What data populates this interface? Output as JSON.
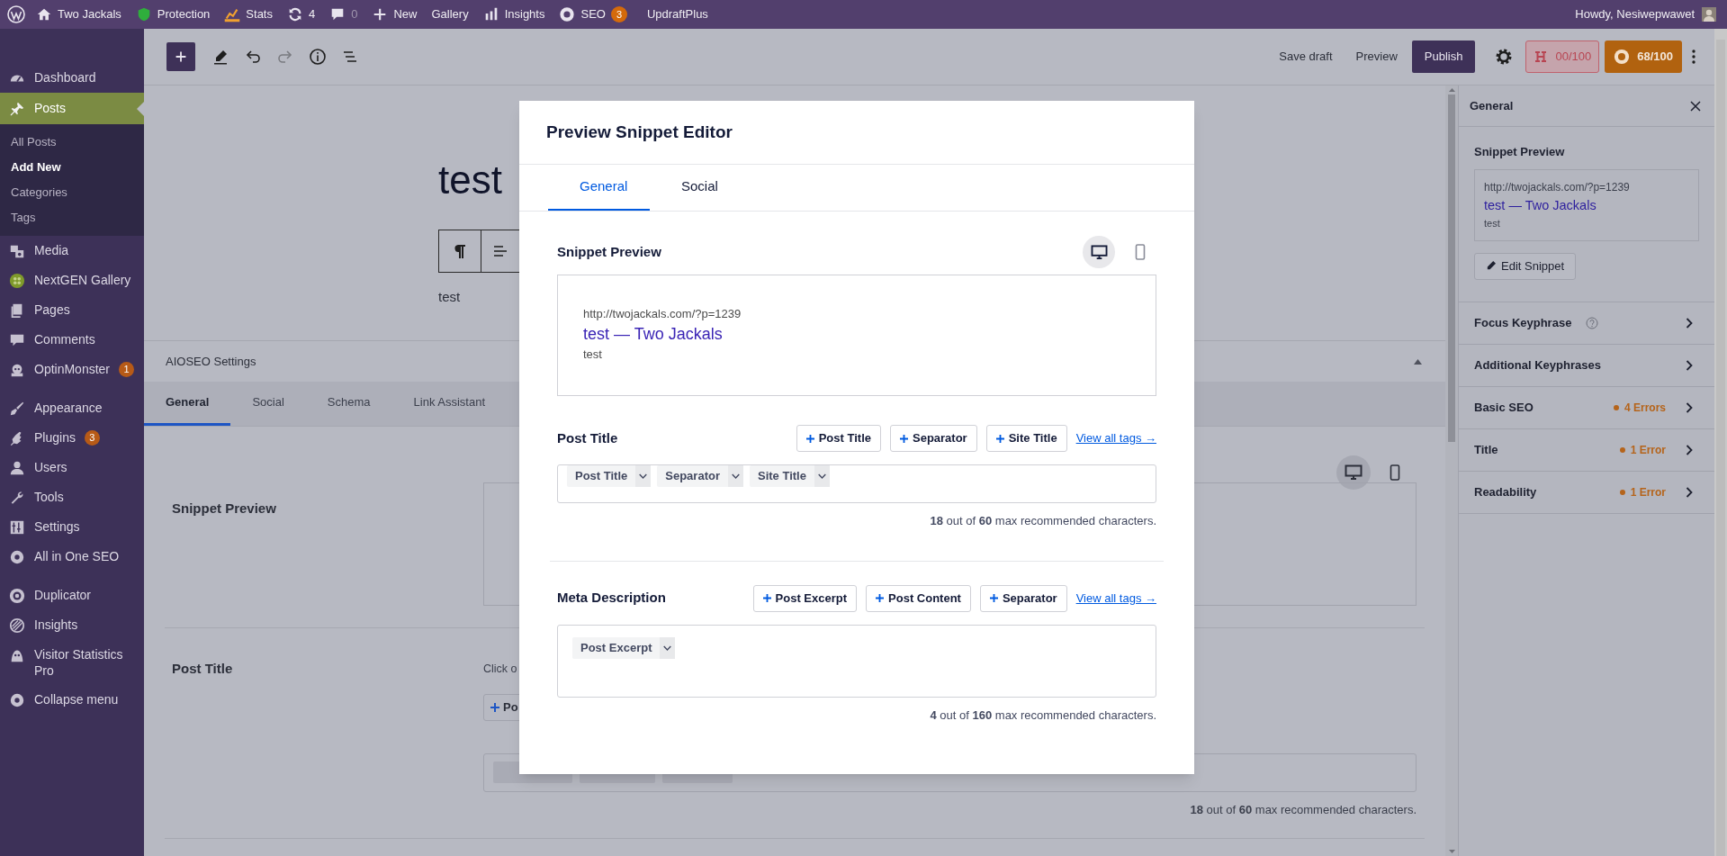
{
  "admin_bar": {
    "items": [
      {
        "label": "Two Jackals"
      },
      {
        "label": "Protection"
      },
      {
        "label": "Stats"
      },
      {
        "label": "4"
      },
      {
        "label": "0"
      },
      {
        "label": "New"
      },
      {
        "label": "Gallery"
      },
      {
        "label": "Insights"
      },
      {
        "label": "SEO",
        "badge": "3"
      },
      {
        "label": "UpdraftPlus"
      }
    ],
    "account": "Howdy, Nesiwepwawet"
  },
  "sidebar": {
    "items": [
      {
        "label": "Dashboard",
        "selected": false
      },
      {
        "label": "Posts",
        "selected": true,
        "children": [
          {
            "label": "All Posts",
            "selected": false
          },
          {
            "label": "Add New",
            "selected": true
          },
          {
            "label": "Categories",
            "selected": false
          },
          {
            "label": "Tags",
            "selected": false
          }
        ]
      },
      {
        "label": "Media",
        "selected": false
      },
      {
        "label": "NextGEN Gallery",
        "selected": false
      },
      {
        "label": "Pages",
        "selected": false
      },
      {
        "label": "Comments",
        "selected": false
      },
      {
        "label": "OptinMonster",
        "selected": false,
        "badge": "1"
      },
      {
        "label": "Appearance",
        "selected": false
      },
      {
        "label": "Plugins",
        "selected": false,
        "badge": "3"
      },
      {
        "label": "Users",
        "selected": false
      },
      {
        "label": "Tools",
        "selected": false
      },
      {
        "label": "Settings",
        "selected": false
      },
      {
        "label": "All in One SEO",
        "selected": false
      },
      {
        "label": "Duplicator",
        "selected": false
      },
      {
        "label": "Insights",
        "selected": false
      },
      {
        "label": "Visitor Statistics Pro",
        "selected": false
      },
      {
        "label": "Collapse menu",
        "selected": false
      }
    ]
  },
  "toolbar": {
    "tools": [
      {
        "disabled": false
      },
      {
        "disabled": false
      },
      {
        "disabled": false
      },
      {
        "disabled": true
      },
      {
        "disabled": false
      },
      {
        "disabled": false
      }
    ],
    "save_draft": "Save draft",
    "preview": "Preview",
    "publish": "Publish",
    "headline_score": "00/100",
    "seo_score": "68/100"
  },
  "post": {
    "title": "test",
    "paragraph": "test"
  },
  "aioseo": {
    "title": "AIOSEO Settings",
    "tabs": [
      {
        "label": "General",
        "selected": true
      },
      {
        "label": "Social",
        "selected": false
      },
      {
        "label": "Schema",
        "selected": false
      },
      {
        "label": "Link Assistant",
        "selected": false
      }
    ],
    "snippet_label": "Snippet Preview",
    "view_toggle": [
      {
        "selected": true
      },
      {
        "selected": false
      }
    ],
    "post_title_label": "Post Title",
    "hint": "Click o",
    "add_button": "Po",
    "count": "**18** out of **60** max recommended characters."
  },
  "panel": {
    "title": "General",
    "snippet_label": "Snippet Preview",
    "url": "http://twojackals.com/?p=1239",
    "link": "test — Two Jackals",
    "description": "test",
    "edit_button": "Edit Snippet",
    "rows": [
      {
        "label": "Focus Keyphrase",
        "help": true
      },
      {
        "label": "Additional Keyphrases",
        "help": false
      },
      {
        "label": "Basic SEO",
        "help": false,
        "status": "4 Errors"
      },
      {
        "label": "Title",
        "help": false,
        "status": "1 Error"
      },
      {
        "label": "Readability",
        "help": false,
        "status": "1 Error"
      }
    ]
  },
  "modal": {
    "title": "Preview Snippet Editor",
    "tabs": [
      {
        "label": "General",
        "selected": true
      },
      {
        "label": "Social",
        "selected": false
      }
    ],
    "snippet_label": "Snippet Preview",
    "view_toggle": [
      {
        "selected": true
      },
      {
        "selected": false
      }
    ],
    "url": "http://twojackals.com/?p=1239",
    "link": "test — Two Jackals",
    "description": "test",
    "sections": [
      {
        "label": "Post Title",
        "add_buttons": [
          "Post Title",
          "Separator",
          "Site Title"
        ],
        "view_all": "View all tags →",
        "tags": [
          "Post Title",
          "Separator",
          "Site Title"
        ],
        "count": "**18** out of **60** max recommended characters."
      },
      {
        "label": "Meta Description",
        "add_buttons": [
          "Post Excerpt",
          "Post Content",
          "Separator"
        ],
        "view_all": "View all tags →",
        "tags": [
          "Post Excerpt"
        ],
        "count": "**4** out of **160** max recommended characters."
      }
    ]
  }
}
